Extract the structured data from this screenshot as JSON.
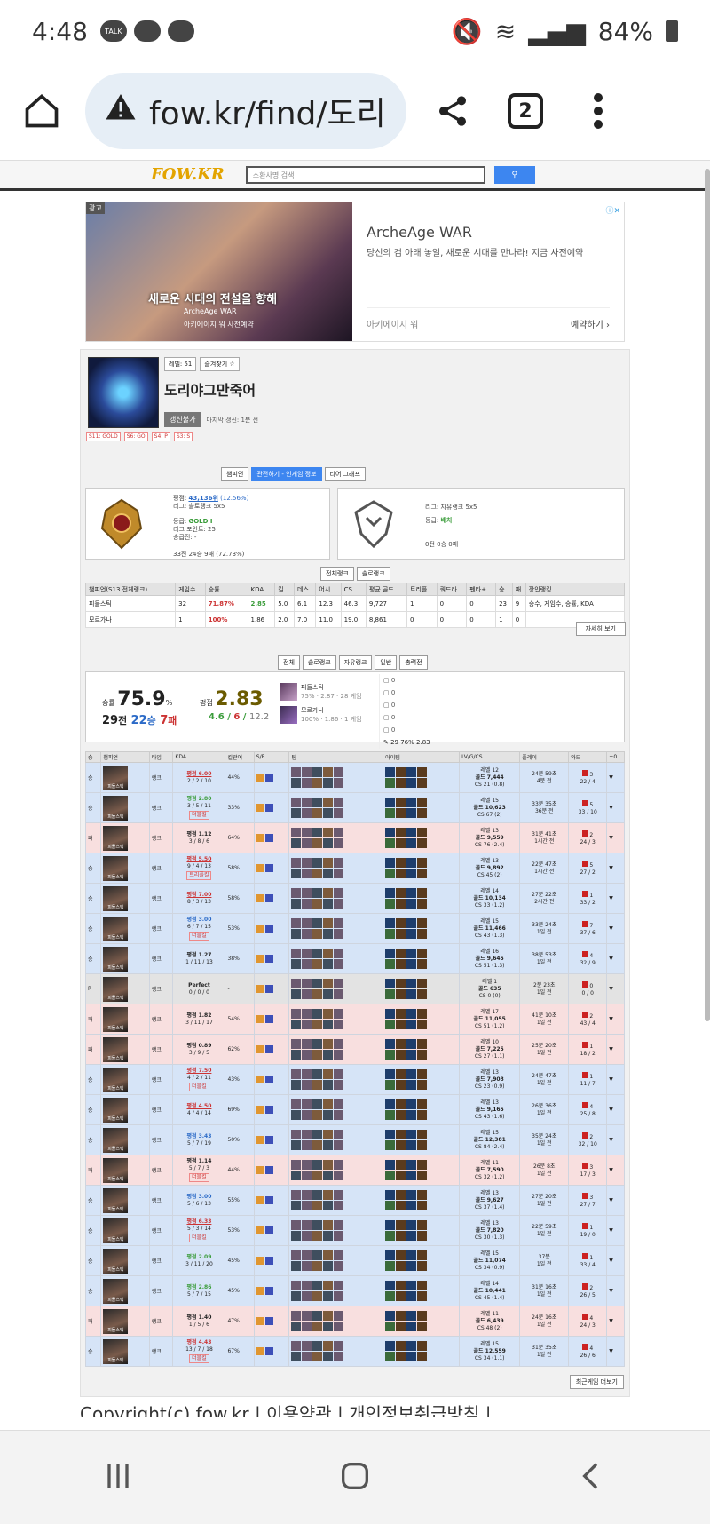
{
  "status": {
    "time": "4:48",
    "talk": "TALK",
    "battery": "84%"
  },
  "browser": {
    "url": "fow.kr/find/도리",
    "tab_count": "2"
  },
  "fow": {
    "logo": "FOW.KR",
    "search_placeholder": "소환사명 검색"
  },
  "ad": {
    "label": "광고",
    "slogan": "새로운 시대의 전설을 향해",
    "brand": "ArcheAge WAR",
    "sub": "아키에이지 워 사전예약",
    "title": "ArcheAge WAR",
    "desc": "당신의 검 아래 놓일, 새로운 시대를 만나라! 지금 사전예약",
    "advertiser": "아키에이지 워",
    "cta": "예약하기"
  },
  "profile": {
    "level": "레벨: 51",
    "favorite": "즐겨찾기 ☆",
    "name": "도리야그만죽어",
    "update_btn": "갱신불가",
    "last_update": "마지막 갱신: 1분 전",
    "seasons": [
      "S11: GOLD",
      "S6: GO",
      "S4: P",
      "S3: S"
    ]
  },
  "view_tabs": [
    "챔피언",
    "관전하기 - 인게임 정보",
    "티어 그래프"
  ],
  "solo_rank": {
    "points": "평점: ",
    "points_val": "43,136위",
    "points_pct": "(12.56%)",
    "league": "리그: 솔로랭크 5x5",
    "tier_label": "등급: ",
    "tier": "GOLD I",
    "lp": "리그 포인트: 25",
    "promo": "승급전: -",
    "record": "33전 24승 9패 (72.73%)"
  },
  "flex_rank": {
    "league": "리그: 자유랭크 5x5",
    "tier_label": "등급: ",
    "tier": "배치",
    "record": "0전 0승 0패"
  },
  "rank_tabs": [
    "전체랭크",
    "솔로랭크"
  ],
  "stat_table": {
    "headers": [
      "챔피언(S13 전체랭크)",
      "게임수",
      "승률",
      "KDA",
      "킬",
      "데스",
      "어시",
      "CS",
      "평균 골드",
      "트리플",
      "쿼드라",
      "펜타+",
      "승",
      "패",
      "장인랭킹"
    ],
    "rows": [
      [
        "피들스틱",
        "32",
        "71.87%",
        "2.85",
        "5.0",
        "6.1",
        "12.3",
        "46.3",
        "9,727",
        "1",
        "0",
        "0",
        "23",
        "9",
        "승수, 게임수, 승률, KDA"
      ],
      [
        "모르가나",
        "1",
        "100%",
        "1.86",
        "2.0",
        "7.0",
        "11.0",
        "19.0",
        "8,861",
        "0",
        "0",
        "0",
        "1",
        "0",
        ""
      ]
    ],
    "detail_btn": "자세히 보기"
  },
  "queue_tabs": [
    "전체",
    "솔로랭크",
    "자유랭크",
    "일반",
    "총력전"
  ],
  "summary": {
    "wr_label": "승률",
    "wr": "75.9",
    "wr_unit": "%",
    "games": "29",
    "games_unit": "전",
    "wins": "22",
    "wins_unit": "승",
    "losses": "7",
    "losses_unit": "패",
    "kda_label": "평점",
    "kda": "2.83",
    "kda_k": "4.6",
    "kda_d": "6",
    "kda_a": "12.2",
    "champ1": "피들스틱",
    "champ1_stat": "75% · 2.87 · 28 게임",
    "champ2": "모르가나",
    "champ2_stat": "100% · 1.86 · 1 게임",
    "positions": [
      "0",
      "0",
      "0",
      "0",
      "0"
    ],
    "total": "29   76%   2.83"
  },
  "games_table": {
    "headers": [
      "승",
      "챔피언",
      "타입",
      "KDA",
      "킬관여",
      "S/R",
      "팀",
      "아이템",
      "LV/G/CS",
      "플레이",
      "와드",
      "+0"
    ],
    "rows": [
      {
        "r": "승",
        "c": "win",
        "t": "랭크",
        "k": "평점 6.00",
        "kc": "high",
        "s": "2 / 2 / 10",
        "tag": "",
        "kp": "44%",
        "lv": "레벨 12",
        "g": "골드 7,444",
        "cs": "CS 21 (0.8)",
        "p": "24분 59초",
        "ago": "4분 전",
        "w": "3",
        "wr": "22 / 4"
      },
      {
        "r": "승",
        "c": "win",
        "t": "랭크",
        "k": "평점 2.80",
        "kc": "mid",
        "s": "3 / 5 / 11",
        "tag": "더블킬",
        "kp": "33%",
        "lv": "레벨 15",
        "g": "골드 10,623",
        "cs": "CS 67 (2)",
        "p": "33분 35초",
        "ago": "36분 전",
        "w": "5",
        "wr": "33 / 10"
      },
      {
        "r": "패",
        "c": "loss",
        "t": "랭크",
        "k": "평점 1.12",
        "kc": "",
        "s": "3 / 8 / 6",
        "tag": "",
        "kp": "64%",
        "lv": "레벨 13",
        "g": "골드 9,559",
        "cs": "CS 76 (2.4)",
        "p": "31분 41초",
        "ago": "1시간 전",
        "w": "2",
        "wr": "24 / 3"
      },
      {
        "r": "승",
        "c": "win",
        "t": "랭크",
        "k": "평점 5.50",
        "kc": "high",
        "s": "9 / 4 / 13",
        "tag": "트리플킬",
        "kp": "58%",
        "lv": "레벨 13",
        "g": "골드 9,892",
        "cs": "CS 45 (2)",
        "p": "22분 47초",
        "ago": "1시간 전",
        "w": "5",
        "wr": "27 / 2"
      },
      {
        "r": "승",
        "c": "win",
        "t": "랭크",
        "k": "평점 7.00",
        "kc": "high",
        "s": "8 / 3 / 13",
        "tag": "",
        "kp": "58%",
        "lv": "레벨 14",
        "g": "골드 10,134",
        "cs": "CS 33 (1.2)",
        "p": "27분 22초",
        "ago": "2시간 전",
        "w": "1",
        "wr": "33 / 2"
      },
      {
        "r": "승",
        "c": "win",
        "t": "랭크",
        "k": "평점 3.00",
        "kc": "low",
        "s": "6 / 7 / 15",
        "tag": "더블킬",
        "kp": "53%",
        "lv": "레벨 15",
        "g": "골드 11,466",
        "cs": "CS 43 (1.3)",
        "p": "33분 24초",
        "ago": "1일 전",
        "w": "7",
        "wr": "37 / 6"
      },
      {
        "r": "승",
        "c": "win",
        "t": "랭크",
        "k": "평점 1.27",
        "kc": "",
        "s": "1 / 11 / 13",
        "tag": "",
        "kp": "38%",
        "lv": "레벨 16",
        "g": "골드 9,645",
        "cs": "CS 51 (1.3)",
        "p": "38분 53초",
        "ago": "1일 전",
        "w": "4",
        "wr": "32 / 9"
      },
      {
        "r": "R",
        "c": "remake",
        "t": "랭크",
        "k": "Perfect",
        "kc": "",
        "s": "0 / 0 / 0",
        "tag": "",
        "kp": "-",
        "lv": "레벨 1",
        "g": "골드 635",
        "cs": "CS 0 (0)",
        "p": "2분 23초",
        "ago": "1일 전",
        "w": "0",
        "wr": "0 / 0"
      },
      {
        "r": "패",
        "c": "loss",
        "t": "랭크",
        "k": "평점 1.82",
        "kc": "",
        "s": "3 / 11 / 17",
        "tag": "",
        "kp": "54%",
        "lv": "레벨 17",
        "g": "골드 11,055",
        "cs": "CS 51 (1.2)",
        "p": "41분 10초",
        "ago": "1일 전",
        "w": "2",
        "wr": "43 / 4"
      },
      {
        "r": "패",
        "c": "loss",
        "t": "랭크",
        "k": "평점 0.89",
        "kc": "",
        "s": "3 / 9 / 5",
        "tag": "",
        "kp": "62%",
        "lv": "레벨 10",
        "g": "골드 7,225",
        "cs": "CS 27 (1.1)",
        "p": "25분 20초",
        "ago": "1일 전",
        "w": "1",
        "wr": "18 / 2"
      },
      {
        "r": "승",
        "c": "win",
        "t": "랭크",
        "k": "평점 7.50",
        "kc": "high",
        "s": "4 / 2 / 11",
        "tag": "더블킬",
        "kp": "43%",
        "lv": "레벨 13",
        "g": "골드 7,908",
        "cs": "CS 23 (0.9)",
        "p": "24분 47초",
        "ago": "1일 전",
        "w": "1",
        "wr": "11 / 7"
      },
      {
        "r": "승",
        "c": "win",
        "t": "랭크",
        "k": "평점 4.50",
        "kc": "high",
        "s": "4 / 4 / 14",
        "tag": "",
        "kp": "69%",
        "lv": "레벨 13",
        "g": "골드 9,165",
        "cs": "CS 43 (1.6)",
        "p": "26분 36초",
        "ago": "1일 전",
        "w": "4",
        "wr": "25 / 8"
      },
      {
        "r": "승",
        "c": "win",
        "t": "랭크",
        "k": "평점 3.43",
        "kc": "low",
        "s": "5 / 7 / 19",
        "tag": "",
        "kp": "50%",
        "lv": "레벨 15",
        "g": "골드 12,381",
        "cs": "CS 84 (2.4)",
        "p": "35분 24초",
        "ago": "1일 전",
        "w": "2",
        "wr": "32 / 10"
      },
      {
        "r": "패",
        "c": "loss",
        "t": "랭크",
        "k": "평점 1.14",
        "kc": "",
        "s": "5 / 7 / 3",
        "tag": "더블킬",
        "kp": "44%",
        "lv": "레벨 11",
        "g": "골드 7,590",
        "cs": "CS 32 (1.2)",
        "p": "26분 8초",
        "ago": "1일 전",
        "w": "3",
        "wr": "17 / 3"
      },
      {
        "r": "승",
        "c": "win",
        "t": "랭크",
        "k": "평점 3.00",
        "kc": "low",
        "s": "5 / 6 / 13",
        "tag": "",
        "kp": "55%",
        "lv": "레벨 13",
        "g": "골드 9,627",
        "cs": "CS 37 (1.4)",
        "p": "27분 20초",
        "ago": "1일 전",
        "w": "3",
        "wr": "27 / 7"
      },
      {
        "r": "승",
        "c": "win",
        "t": "랭크",
        "k": "평점 6.33",
        "kc": "high",
        "s": "5 / 3 / 14",
        "tag": "더블킬",
        "kp": "53%",
        "lv": "레벨 13",
        "g": "골드 7,820",
        "cs": "CS 30 (1.3)",
        "p": "22분 59초",
        "ago": "1일 전",
        "w": "1",
        "wr": "19 / 0"
      },
      {
        "r": "승",
        "c": "win",
        "t": "랭크",
        "k": "평점 2.09",
        "kc": "mid",
        "s": "3 / 11 / 20",
        "tag": "",
        "kp": "45%",
        "lv": "레벨 15",
        "g": "골드 11,074",
        "cs": "CS 34 (0.9)",
        "p": "37분",
        "ago": "1일 전",
        "w": "1",
        "wr": "33 / 4"
      },
      {
        "r": "승",
        "c": "win",
        "t": "랭크",
        "k": "평점 2.86",
        "kc": "mid",
        "s": "5 / 7 / 15",
        "tag": "",
        "kp": "45%",
        "lv": "레벨 14",
        "g": "골드 10,441",
        "cs": "CS 45 (1.4)",
        "p": "31분 16초",
        "ago": "1일 전",
        "w": "2",
        "wr": "26 / 5"
      },
      {
        "r": "패",
        "c": "loss",
        "t": "랭크",
        "k": "평점 1.40",
        "kc": "",
        "s": "1 / 5 / 6",
        "tag": "",
        "kp": "47%",
        "lv": "레벨 11",
        "g": "골드 6,439",
        "cs": "CS 48 (2)",
        "p": "24분 16초",
        "ago": "1일 전",
        "w": "4",
        "wr": "24 / 3"
      },
      {
        "r": "승",
        "c": "win",
        "t": "랭크",
        "k": "평점 4.43",
        "kc": "high",
        "s": "13 / 7 / 18",
        "tag": "더블킬",
        "kp": "67%",
        "lv": "레벨 15",
        "g": "골드 12,559",
        "cs": "CS 34 (1.1)",
        "p": "31분 35초",
        "ago": "1일 전",
        "w": "4",
        "wr": "26 / 6"
      }
    ],
    "champ_name": "피들스틱",
    "more_btn": "최근게임 더보기"
  },
  "footer": {
    "copyright": "Copyright(c) fow.kr | 이용약관 | 개인정보취급방침 |"
  }
}
